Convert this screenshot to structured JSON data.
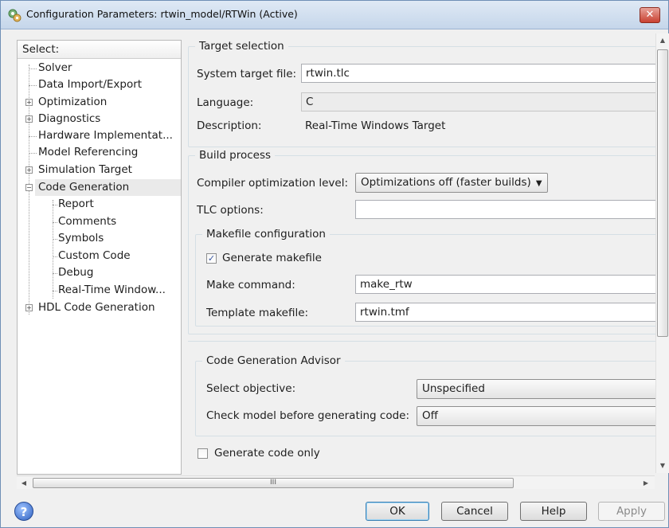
{
  "window": {
    "title": "Configuration Parameters: rtwin_model/RTWin (Active)",
    "close_glyph": "✕"
  },
  "tree": {
    "header": "Select:",
    "items": [
      {
        "label": "Solver"
      },
      {
        "label": "Data Import/Export"
      },
      {
        "label": "Optimization"
      },
      {
        "label": "Diagnostics"
      },
      {
        "label": "Hardware Implementat..."
      },
      {
        "label": "Model Referencing"
      },
      {
        "label": "Simulation Target"
      },
      {
        "label": "Code Generation"
      },
      {
        "label": "Report"
      },
      {
        "label": "Comments"
      },
      {
        "label": "Symbols"
      },
      {
        "label": "Custom Code"
      },
      {
        "label": "Debug"
      },
      {
        "label": "Real-Time Window..."
      },
      {
        "label": "HDL Code Generation"
      }
    ],
    "expand_plus": "+",
    "expand_minus": "−",
    "selected": "Code Generation"
  },
  "target_selection": {
    "title": "Target selection",
    "system_target_label": "System target file:",
    "system_target_value": "rtwin.tlc",
    "language_label": "Language:",
    "language_value": "C",
    "description_label": "Description:",
    "description_value": "Real-Time Windows Target"
  },
  "build_process": {
    "title": "Build process",
    "compiler_opt_label": "Compiler optimization level:",
    "compiler_opt_value": "Optimizations off (faster builds)",
    "tlc_options_label": "TLC options:",
    "tlc_options_value": "",
    "makefile": {
      "title": "Makefile configuration",
      "generate_makefile_label": "Generate makefile",
      "generate_makefile_checked": true,
      "make_command_label": "Make command:",
      "make_command_value": "make_rtw",
      "template_label": "Template makefile:",
      "template_value": "rtwin.tmf"
    }
  },
  "advisor": {
    "title": "Code Generation Advisor",
    "select_objective_label": "Select objective:",
    "select_objective_value": "Unspecified",
    "check_model_label": "Check model before generating code:",
    "check_model_value": "Off"
  },
  "generate_code_only_label": "Generate code only",
  "generate_code_only_checked": false,
  "scrollbar": {
    "thumb_grip": "III"
  },
  "buttons": {
    "ok": "OK",
    "cancel": "Cancel",
    "help": "Help",
    "apply": "Apply"
  },
  "icons": {
    "help": "?",
    "check": "✓",
    "caret": "▼"
  }
}
